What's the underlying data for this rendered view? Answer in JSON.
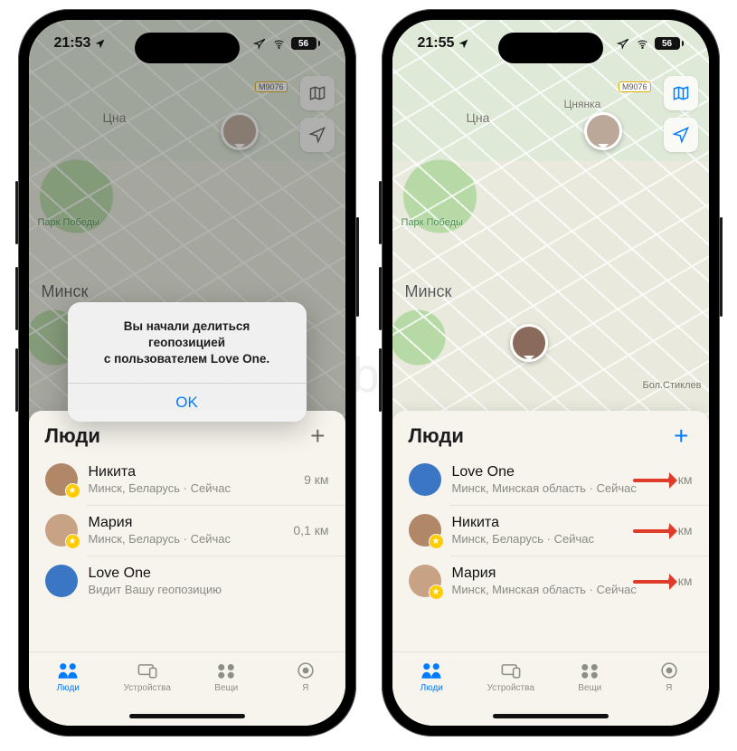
{
  "watermark": "Yablyk",
  "left": {
    "time": "21:53",
    "battery": "56",
    "map": {
      "city": "Минск",
      "town": "Цна",
      "park": "Парк Победы",
      "road": "M9076"
    },
    "alert": {
      "line1": "Вы начали делиться",
      "line2": "геопозицией",
      "line3": "с пользователем Love One.",
      "ok": "OK"
    },
    "sheet_title": "Люди",
    "people": [
      {
        "name": "Никита",
        "sub": "Минск, Беларусь · Сейчас",
        "dist": "9 км"
      },
      {
        "name": "Мария",
        "sub": "Минск, Беларусь · Сейчас",
        "dist": "0,1 км"
      },
      {
        "name": "Love One",
        "sub": "Видит Вашу геопозицию",
        "dist": ""
      }
    ]
  },
  "right": {
    "time": "21:55",
    "battery": "56",
    "map": {
      "city": "Минск",
      "town": "Цна",
      "park": "Парк Победы",
      "town2": "Цнянка",
      "road": "M9076",
      "street": "Бол.Стиклев"
    },
    "sheet_title": "Люди",
    "people": [
      {
        "name": "Love One",
        "sub": "Минск, Минская область · Сейчас",
        "dist": "0 км"
      },
      {
        "name": "Никита",
        "sub": "Минск, Беларусь · Сейчас",
        "dist": "9 км"
      },
      {
        "name": "Мария",
        "sub": "Минск, Минская область · Сейчас",
        "dist": "0 км"
      }
    ]
  },
  "tabs": {
    "people": "Люди",
    "devices": "Устройства",
    "items": "Вещи",
    "me": "Я"
  }
}
